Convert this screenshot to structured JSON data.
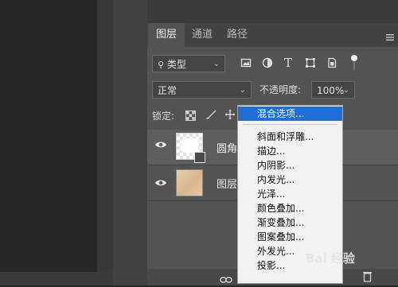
{
  "tabs": [
    {
      "label": "图层"
    },
    {
      "label": "通道"
    },
    {
      "label": "路径"
    }
  ],
  "filter": {
    "label": "类型"
  },
  "blend": {
    "mode": "正常",
    "opacity_label": "不透明度:",
    "opacity_value": "100%"
  },
  "lock": {
    "label": "锁定:"
  },
  "layers": [
    {
      "name": "圆角"
    },
    {
      "name": "图层"
    }
  ],
  "context_menu": {
    "items": [
      "混合选项...",
      "斜面和浮雕...",
      "描边...",
      "内阴影...",
      "内发光...",
      "光泽...",
      "颜色叠加...",
      "渐变叠加...",
      "图案叠加...",
      "外发光...",
      "投影..."
    ]
  },
  "watermark": {
    "text": "Bai 经验"
  },
  "colors": {
    "panel": "#535353",
    "highlight": "#1e6fd6",
    "menu_bg": "#f2f2f2"
  }
}
